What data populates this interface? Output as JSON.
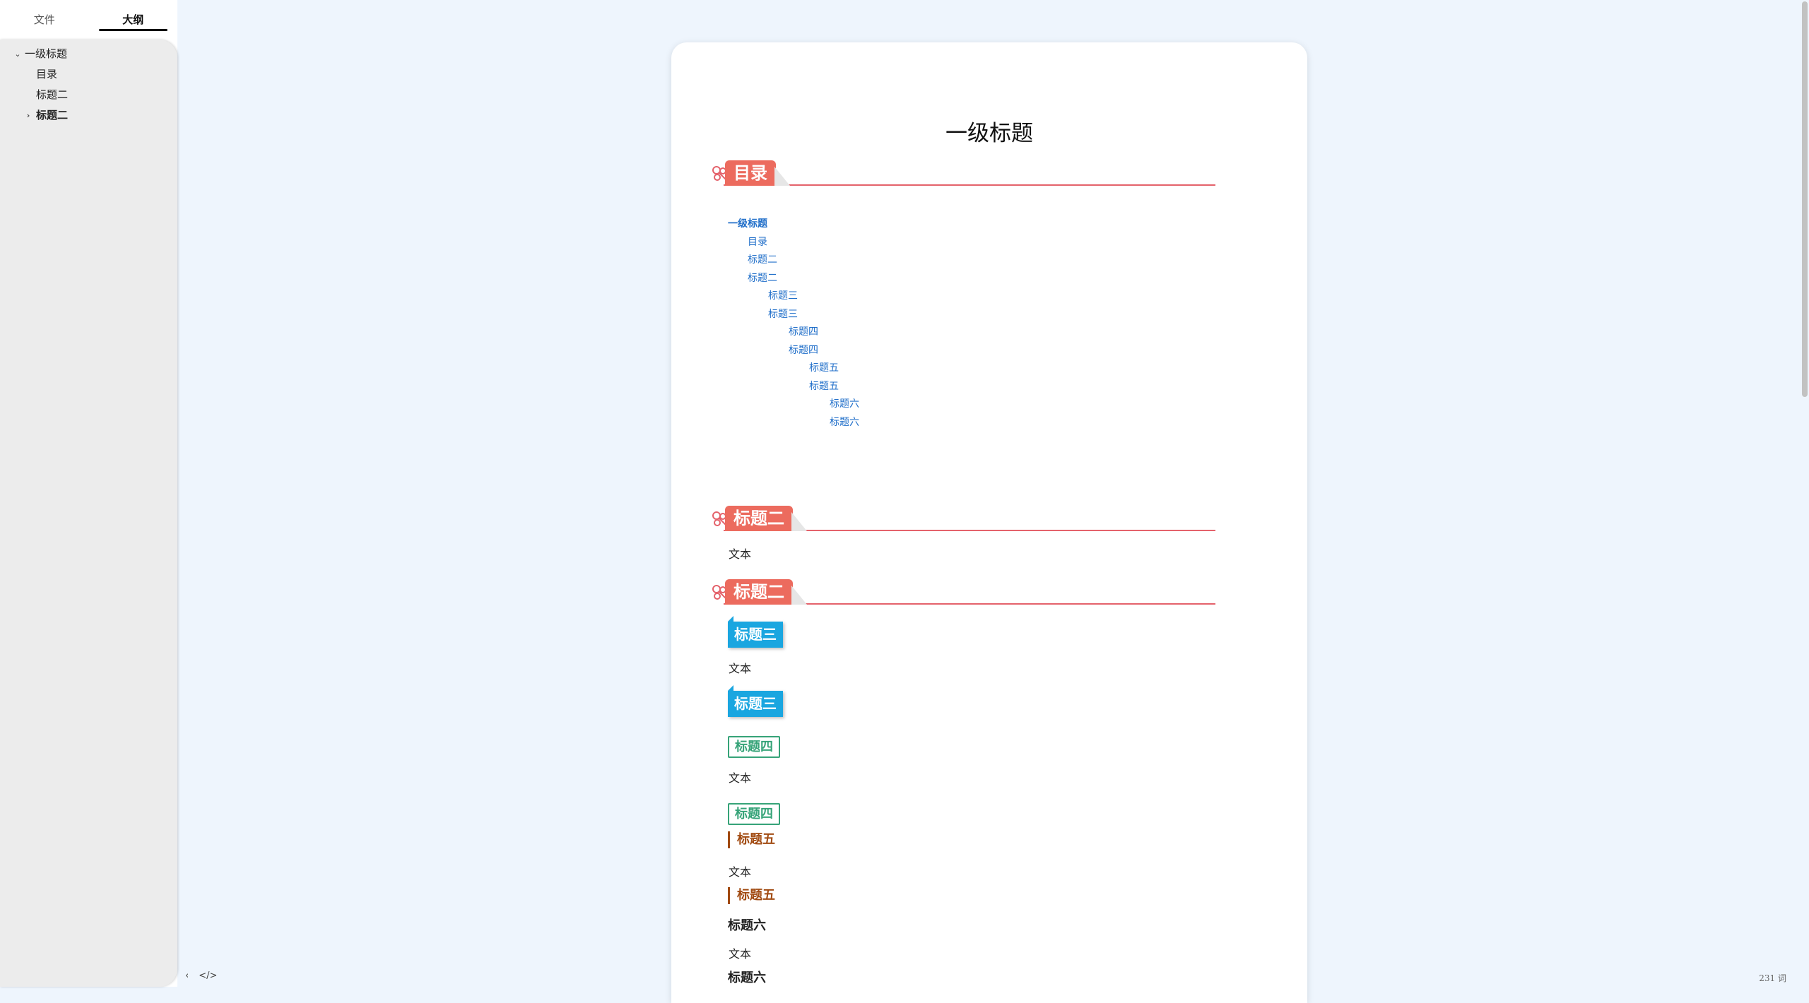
{
  "sidebar": {
    "tabs": [
      {
        "label": "文件",
        "active": false
      },
      {
        "label": "大纲",
        "active": true
      }
    ],
    "outline": [
      {
        "label": "一级标题",
        "level": 1,
        "expanded": true,
        "bold": false
      },
      {
        "label": "目录",
        "level": 2,
        "bold": false
      },
      {
        "label": "标题二",
        "level": 2,
        "bold": false
      },
      {
        "label": "标题二",
        "level": 2,
        "collapsed": true,
        "bold": true
      }
    ]
  },
  "status": {
    "word_count": "231 词",
    "icons": [
      "chevron-left-icon",
      "source-code-icon"
    ]
  },
  "document": {
    "title": "一级标题",
    "sections": {
      "toc_heading": "目录",
      "h2_a": "标题二",
      "h2_b": "标题二",
      "h3_a": "标题三",
      "h3_b": "标题三",
      "h4_a": "标题四",
      "h4_b": "标题四",
      "h5_a": "标题五",
      "h5_b": "标题五",
      "h6_a": "标题六",
      "h6_b": "标题六"
    },
    "body_text": "文本",
    "toc": [
      {
        "label": "一级标题",
        "level": 1
      },
      {
        "label": "目录",
        "level": 2
      },
      {
        "label": "标题二",
        "level": 2
      },
      {
        "label": "标题二",
        "level": 2
      },
      {
        "label": "标题三",
        "level": 3
      },
      {
        "label": "标题三",
        "level": 3
      },
      {
        "label": "标题四",
        "level": 4
      },
      {
        "label": "标题四",
        "level": 4
      },
      {
        "label": "标题五",
        "level": 5
      },
      {
        "label": "标题五",
        "level": 5
      },
      {
        "label": "标题六",
        "level": 6
      },
      {
        "label": "标题六",
        "level": 6
      }
    ]
  },
  "colors": {
    "h2_ribbon": "#ec6b5e",
    "h2_rule": "#e4626b",
    "h3": "#1aa6e0",
    "h4": "#36a378",
    "h5": "#a14a11",
    "link": "#1f6ec9",
    "background": "#eef5fd"
  }
}
